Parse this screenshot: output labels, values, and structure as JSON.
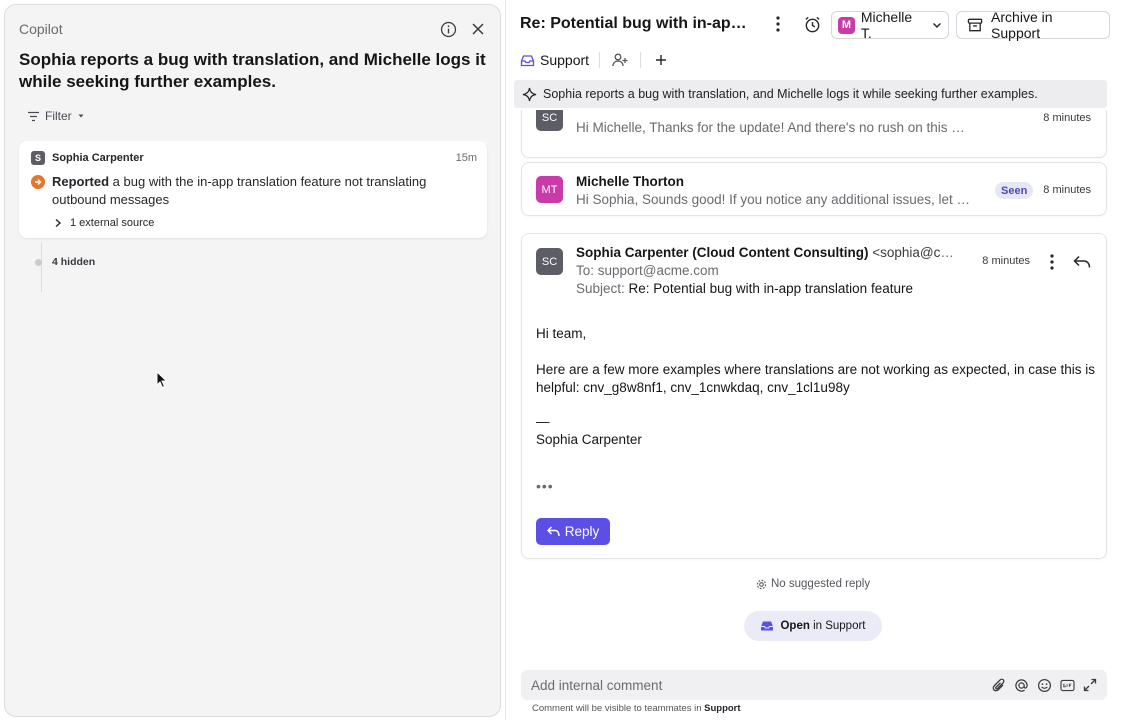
{
  "copilot": {
    "title": "Copilot",
    "summary": "Sophia reports a bug with translation, and Michelle logs it while seeking further examples.",
    "filter_label": "Filter",
    "card": {
      "avatar_letter": "S",
      "name": "Sophia Carpenter",
      "time": "15m",
      "event_bold": "Reported",
      "event_text": " a bug with the in-app translation feature not translating outbound messages",
      "external_source": "1 external source"
    },
    "hidden_label": "4 hidden"
  },
  "conversation": {
    "title": "Re: Potential bug with in-app t...",
    "assignee": {
      "badge": "M",
      "name": "Michelle T."
    },
    "archive_label": "Archive in Support",
    "inbox_tag": "Support",
    "summary": "Sophia reports a bug with translation, and Michelle logs it while seeking further examples.",
    "messages": [
      {
        "avatar": "SC",
        "preview": "Hi Michelle, Thanks for the update! And there's no rush on this for me - I...",
        "time": "8 minutes"
      },
      {
        "avatar": "MT",
        "name": "Michelle Thorton",
        "preview": "Hi Sophia, Sounds good! If you notice any additional issues, let m...",
        "status": "Seen",
        "time": "8 minutes"
      }
    ],
    "email": {
      "avatar": "SC",
      "sender_name": "Sophia Carpenter (Cloud Content Consulting)",
      "sender_email": "<sophia@clou...",
      "time": "8 minutes",
      "to_label": "To:",
      "to_value": "support@acme.com",
      "subject_label": "Subject:",
      "subject_value": "Re: Potential bug with in-app translation feature",
      "greeting": "Hi team,",
      "body": "Here are a few more examples where translations are not working as expected, in case this is helpful: cnv_g8w8nf1, cnv_1cnwkdaq, cnv_1cl1u98y",
      "sig_dash": "—",
      "signature": "Sophia Carpenter",
      "dots": "•••",
      "reply_label": "Reply"
    },
    "no_suggested_reply": "No suggested reply",
    "open_pill": {
      "bold": "Open",
      "rest": "in Support"
    },
    "comment_placeholder": "Add internal comment",
    "comment_hint_prefix": "Comment will be visible to teammates in",
    "comment_hint_team": "Support"
  },
  "colors": {
    "accent": "#5b4fe6",
    "event_orange": "#e5772d",
    "michelle_pink": "#c93bab",
    "avatar_gray": "#5d5d66"
  }
}
